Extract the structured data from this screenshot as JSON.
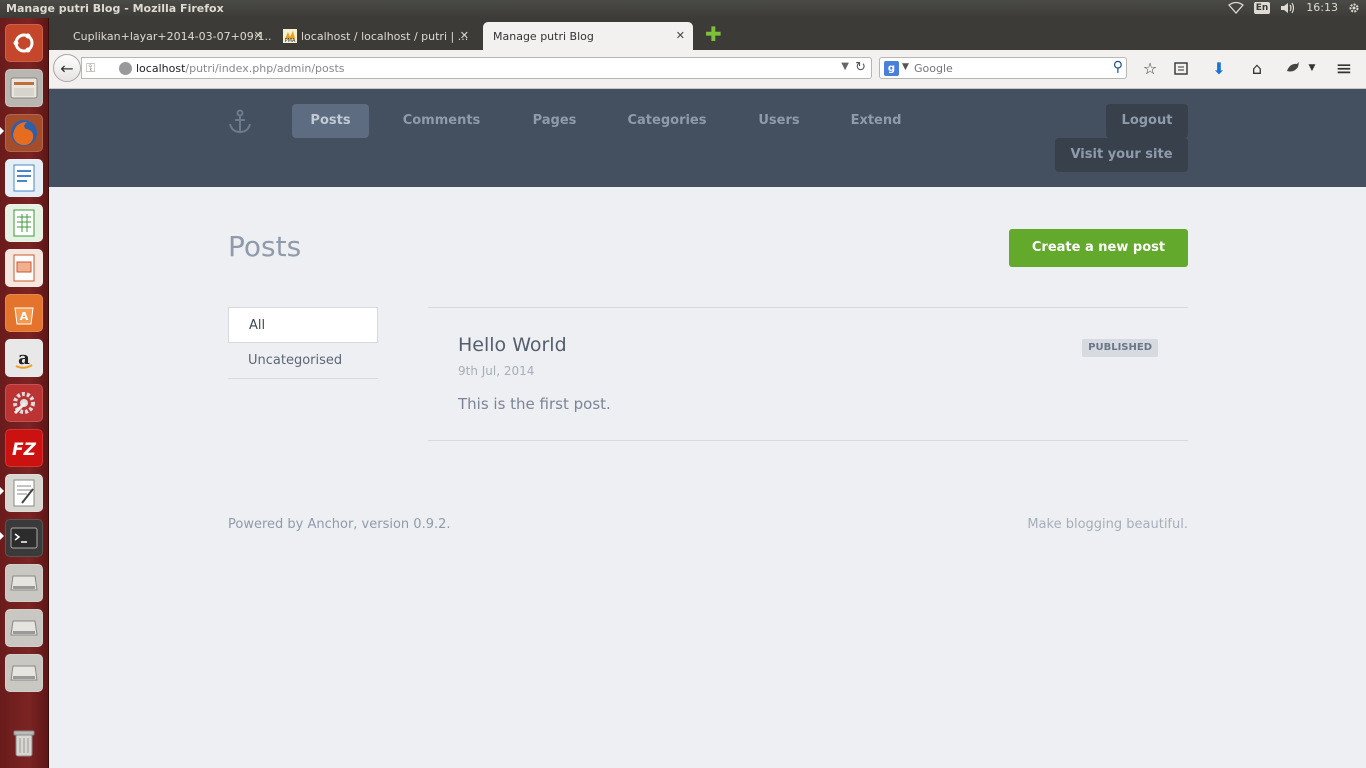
{
  "os": {
    "window_title": "Manage putri Blog - Mozilla Firefox",
    "keyboard_lang": "En",
    "clock": "16:13"
  },
  "browser": {
    "tabs": [
      {
        "label": "Cuplikan+layar+2014-03-07+09:1..."
      },
      {
        "label": "localhost / localhost / putri | ..."
      },
      {
        "label": "Manage putri Blog"
      }
    ],
    "url_host": "localhost",
    "url_path": "/putri/index.php/admin/posts",
    "search_placeholder": "Google"
  },
  "header": {
    "nav": [
      {
        "label": "Posts"
      },
      {
        "label": "Comments"
      },
      {
        "label": "Pages"
      },
      {
        "label": "Categories"
      },
      {
        "label": "Users"
      },
      {
        "label": "Extend"
      }
    ],
    "logout_label": "Logout",
    "visit_label": "Visit your site"
  },
  "main": {
    "title": "Posts",
    "create_label": "Create a new post",
    "categories": [
      {
        "label": "All"
      },
      {
        "label": "Uncategorised"
      }
    ],
    "posts": [
      {
        "title": "Hello World",
        "date": "9th Jul, 2014",
        "excerpt": "This is the first post.",
        "status": "PUBLISHED"
      }
    ]
  },
  "footer": {
    "left": "Powered by Anchor, version 0.9.2.",
    "right": "Make blogging beautiful."
  },
  "colors": {
    "header_bg": "#444f5f",
    "page_bg": "#eeeff2",
    "create_button": "#62a92c",
    "launcher": "#7c2424"
  }
}
